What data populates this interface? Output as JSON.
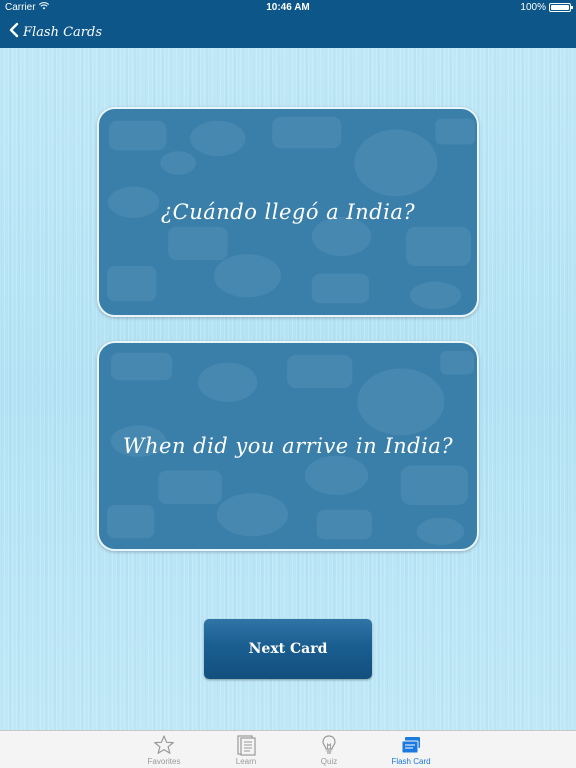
{
  "status_bar": {
    "carrier": "Carrier",
    "time": "10:46 AM",
    "battery_text": "100%",
    "battery_level": 1.0
  },
  "nav": {
    "back_label": "Flash Cards"
  },
  "cards": {
    "question": "¿Cuándo llegó a India?",
    "answer": "When did you arrive in India?"
  },
  "actions": {
    "next_label": "Next Card"
  },
  "tabs": [
    {
      "label": "Favorites",
      "icon": "star-icon",
      "active": false
    },
    {
      "label": "Learn",
      "icon": "book-icon",
      "active": false
    },
    {
      "label": "Quiz",
      "icon": "lightbulb-icon",
      "active": false
    },
    {
      "label": "Flash Card",
      "icon": "flash-card-icon",
      "active": true
    }
  ],
  "colors": {
    "bar": "#0d5689",
    "card": "#3a7faa",
    "background": "#b7e3f4",
    "tab_active": "#1a7ae0",
    "tab_inactive": "#9a9a9a"
  }
}
